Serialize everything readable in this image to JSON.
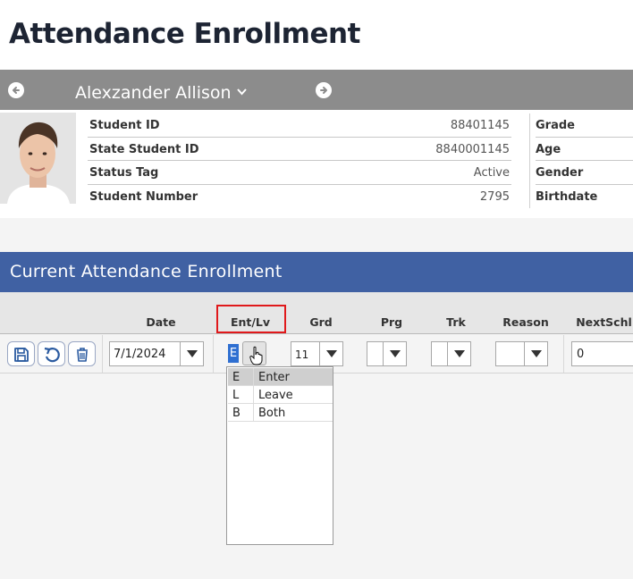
{
  "page": {
    "title": "Attendance Enrollment"
  },
  "student": {
    "name": "Alexzander Allison",
    "fields": [
      {
        "label": "Student ID",
        "value": "88401145"
      },
      {
        "label": "State Student ID",
        "value": "8840001145"
      },
      {
        "label": "Status Tag",
        "value": "Active"
      },
      {
        "label": "Student Number",
        "value": "2795"
      }
    ],
    "fields2": [
      {
        "label": "Grade"
      },
      {
        "label": "Age"
      },
      {
        "label": "Gender"
      },
      {
        "label": "Birthdate"
      }
    ]
  },
  "section": {
    "title": "Current Attendance Enrollment"
  },
  "columns": {
    "date": "Date",
    "entlv": "Ent/Lv",
    "grd": "Grd",
    "prg": "Prg",
    "trk": "Trk",
    "reason": "Reason",
    "nextschl": "NextSchl"
  },
  "row": {
    "date": "7/1/2024",
    "entlv": "E",
    "grd": "11",
    "prg": "",
    "trk": "",
    "reason": "",
    "nextschl": "0"
  },
  "entlv_options": [
    {
      "code": "E",
      "label": "Enter",
      "selected": true
    },
    {
      "code": "L",
      "label": "Leave",
      "selected": false
    },
    {
      "code": "B",
      "label": "Both",
      "selected": false
    }
  ],
  "icons": {
    "save": "save-icon",
    "undo": "undo-icon",
    "delete": "trash-icon",
    "prev": "arrow-left-circle-icon",
    "next": "arrow-right-circle-icon"
  },
  "colors": {
    "section_header": "#4061a3",
    "nav_bar": "#8c8c8c",
    "highlight": "#e0191b",
    "selection": "#2f6fd1"
  }
}
